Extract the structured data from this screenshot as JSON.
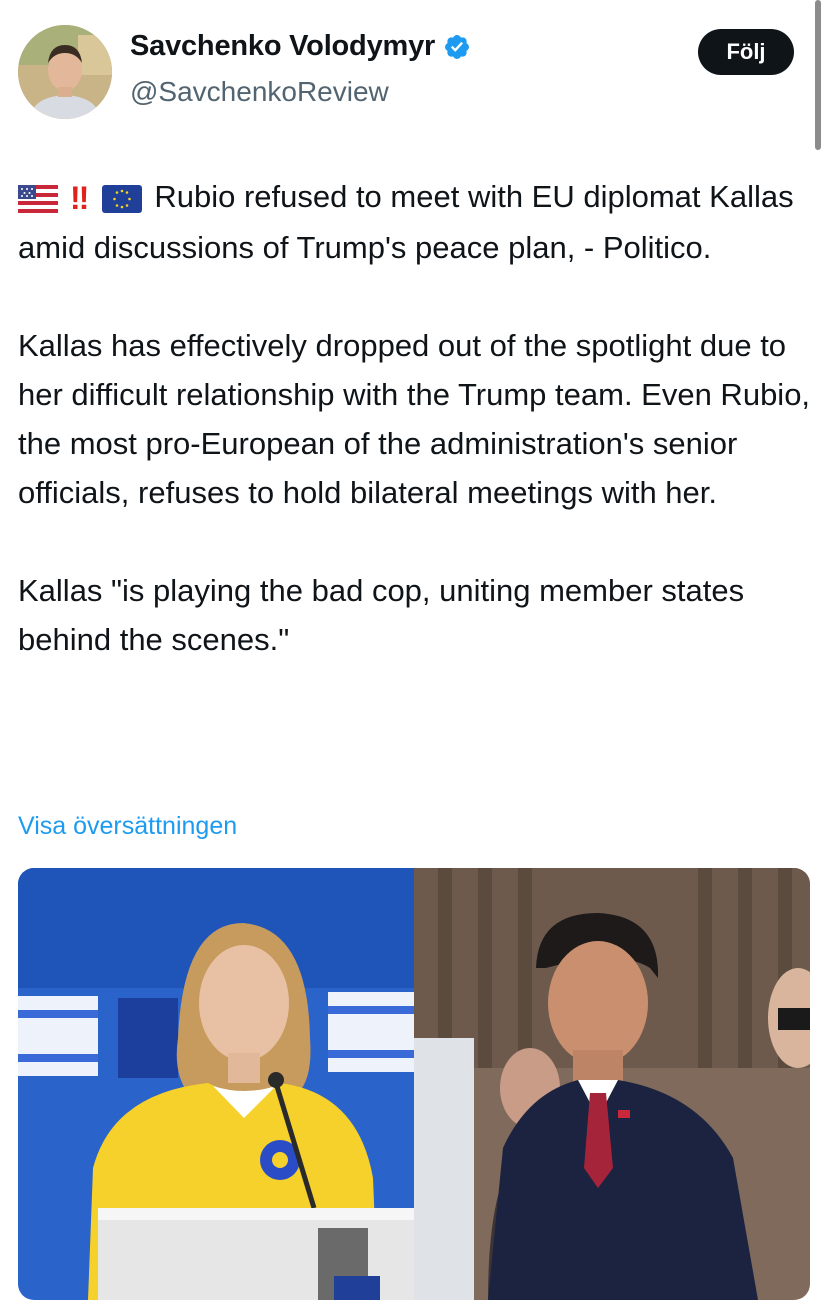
{
  "author": {
    "display_name": "Savchenko Volodymyr",
    "handle": "@SavchenkoReview",
    "verified_icon": "verified-badge-icon",
    "avatar_icon": "profile-photo"
  },
  "follow_button": {
    "label": "Följ"
  },
  "tweet": {
    "lead_emojis": [
      "us-flag-icon",
      "double-exclamation-icon",
      "eu-flag-icon"
    ],
    "double_exclamation": "‼",
    "paragraphs": [
      "Rubio refused to meet with EU diplomat Kallas amid discussions of Trump's peace plan, - Politico.",
      "Kallas has effectively dropped out of the spotlight due to her difficult relationship with the Trump team. Even Rubio, the most pro-European of the administration's senior officials, refuses to hold bilateral meetings with her.",
      "Kallas \"is playing the bad cop, uniting member states behind the scenes.\""
    ]
  },
  "translate_link": "Visa översättningen",
  "media": {
    "left_image": "woman-in-yellow-at-podium",
    "right_image": "man-in-suit-outdoors"
  },
  "colors": {
    "link": "#1d9bf0",
    "verified": "#1d9bf0",
    "text": "#0f1419",
    "secondary": "#536471",
    "button": "#0f1419"
  }
}
